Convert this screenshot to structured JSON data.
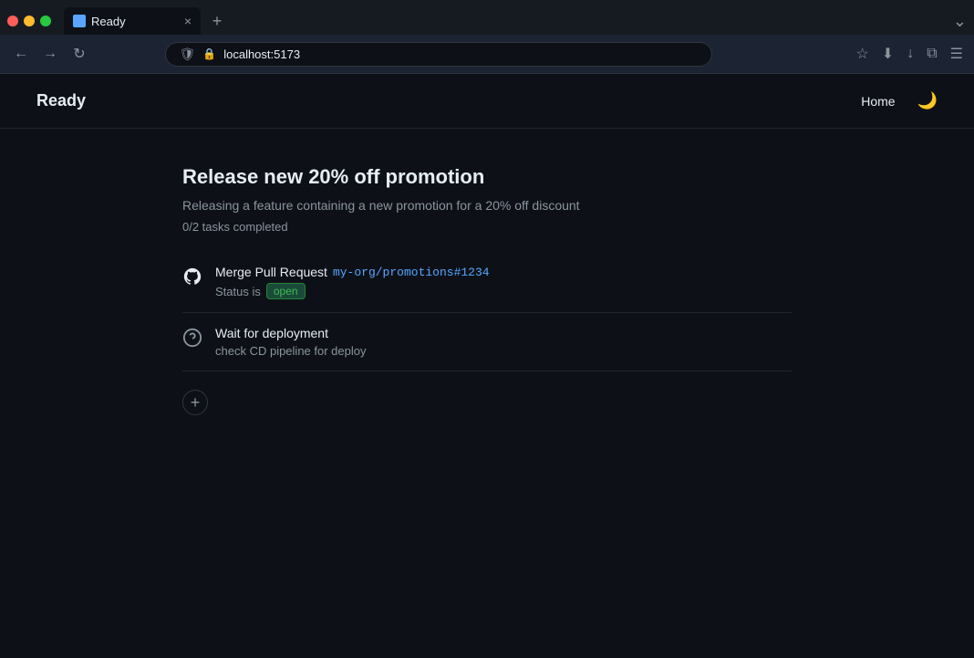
{
  "browser": {
    "tab_title": "Ready",
    "url": "localhost:5173",
    "tab_close": "×",
    "tab_new": "+",
    "tab_overflow": "⌄",
    "nav_back": "←",
    "nav_forward": "→",
    "nav_reload": "↻"
  },
  "app": {
    "logo": "Ready",
    "nav": {
      "home_label": "Home"
    },
    "page": {
      "title": "Release new 20% off promotion",
      "description": "Releasing a feature containing a new promotion for a 20% off discount",
      "tasks_count": "0/2 tasks completed"
    },
    "tasks": [
      {
        "icon_type": "github",
        "title_prefix": "Merge Pull Request",
        "link_text": "my-org/promotions#1234",
        "status_label": "Status is",
        "badge_text": "open"
      },
      {
        "icon_type": "question",
        "title": "Wait for deployment",
        "subtitle": "check CD pipeline for deploy"
      }
    ],
    "add_task_label": "+"
  }
}
